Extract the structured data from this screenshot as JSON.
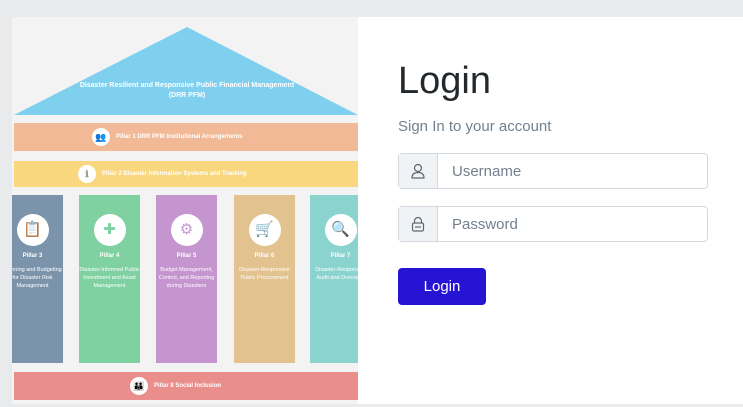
{
  "illustration": {
    "roof_title": "Disaster Resilient and Responsive Public Financial Management (DRR PFM)",
    "bands": [
      {
        "label": "Pillar 1 DRR PFM Institutional Arrangements",
        "icon": "people-icon"
      },
      {
        "label": "Pillar 2 Disaster Information Systems and Tracking",
        "icon": "info-icon"
      },
      {
        "label": "Pillar 8 Social Inclusion",
        "icon": "group-icon"
      }
    ],
    "pillars": [
      {
        "name": "Pillar 3",
        "text": "Planning and Budgeting for Disaster Risk Management",
        "icon": "clipboard-icon",
        "glyph": "📋"
      },
      {
        "name": "Pillar 4",
        "text": "Disaster-Informed Public Investment and Asset Management",
        "icon": "puzzle-icon",
        "glyph": "✚"
      },
      {
        "name": "Pillar 5",
        "text": "Budget Management, Control, and Reporting during Disasters",
        "icon": "gears-icon",
        "glyph": "⚙"
      },
      {
        "name": "Pillar 6",
        "text": "Disaster-Responsive Public Procurement",
        "icon": "cart-icon",
        "glyph": "🛒"
      },
      {
        "name": "Pillar 7",
        "text": "Disaster-Responsive Audit and Oversight",
        "icon": "magnifier-icon",
        "glyph": "🔍"
      }
    ]
  },
  "login": {
    "title": "Login",
    "subtitle": "Sign In to your account",
    "username_placeholder": "Username",
    "password_placeholder": "Password",
    "button_label": "Login"
  },
  "colors": {
    "accent": "#2514d4",
    "roof": "#7fd0ef"
  }
}
